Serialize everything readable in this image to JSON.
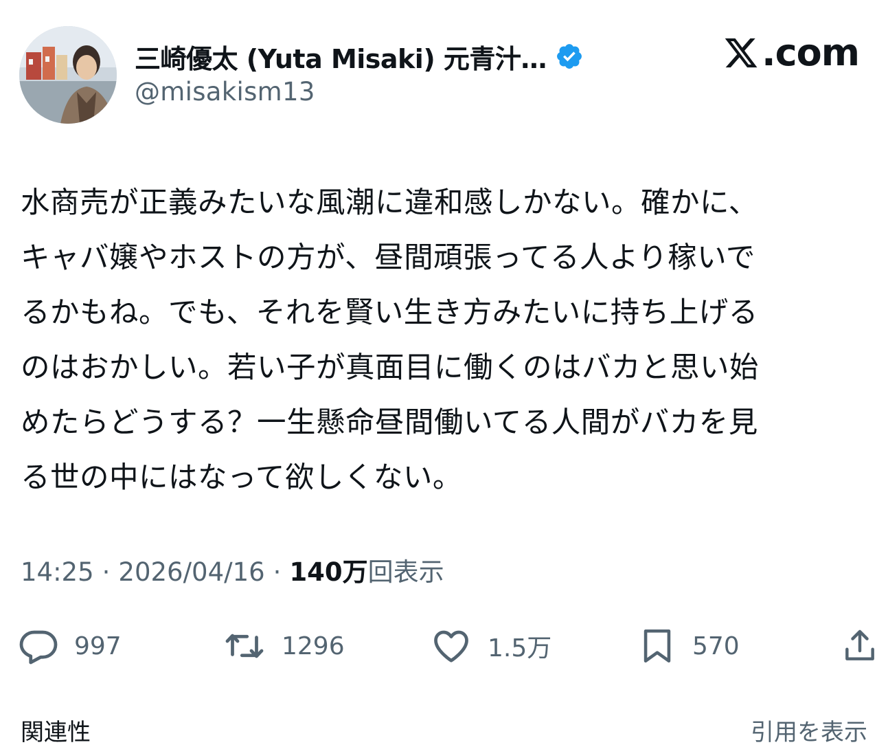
{
  "brand": {
    "text": ".com",
    "icon": "x-logo-icon"
  },
  "author": {
    "display_name": "三崎優太 (Yuta Misaki) 元青汁…",
    "handle": "@misakism13",
    "verified_icon": "verified-badge-icon",
    "verified_color": "#1d9bf0",
    "avatar_icon": "avatar-photo"
  },
  "tweet": {
    "lines": [
      "水商売が正義みたいな風潮に違和感しかない。確かに、",
      "キャバ嬢やホストの方が、昼間頑張ってる人より稼いで",
      "るかもね。でも、それを賢い生き方みたいに持ち上げる",
      "のはおかしい。若い子が真面目に働くのはバカと思い始",
      "めたらどうする？一生懸命昼間働いてる人間がバカを見",
      "る世の中にはなって欲しくない。"
    ]
  },
  "meta": {
    "time": "14:25",
    "separator": "·",
    "date": "2026/04/16",
    "views_count": "140万",
    "views_label": "回表示"
  },
  "actions": {
    "reply_count": "997",
    "retweet_count": "1296",
    "like_count": "1.5万",
    "bookmark_count": "570",
    "icons": [
      "reply-icon",
      "retweet-icon",
      "like-icon",
      "bookmark-icon",
      "share-icon"
    ]
  },
  "footer": {
    "left_label": "関連性",
    "right_label": "引用を表示"
  },
  "colors": {
    "text": "#0f1419",
    "secondary": "#536471",
    "accent": "#1d9bf0"
  }
}
